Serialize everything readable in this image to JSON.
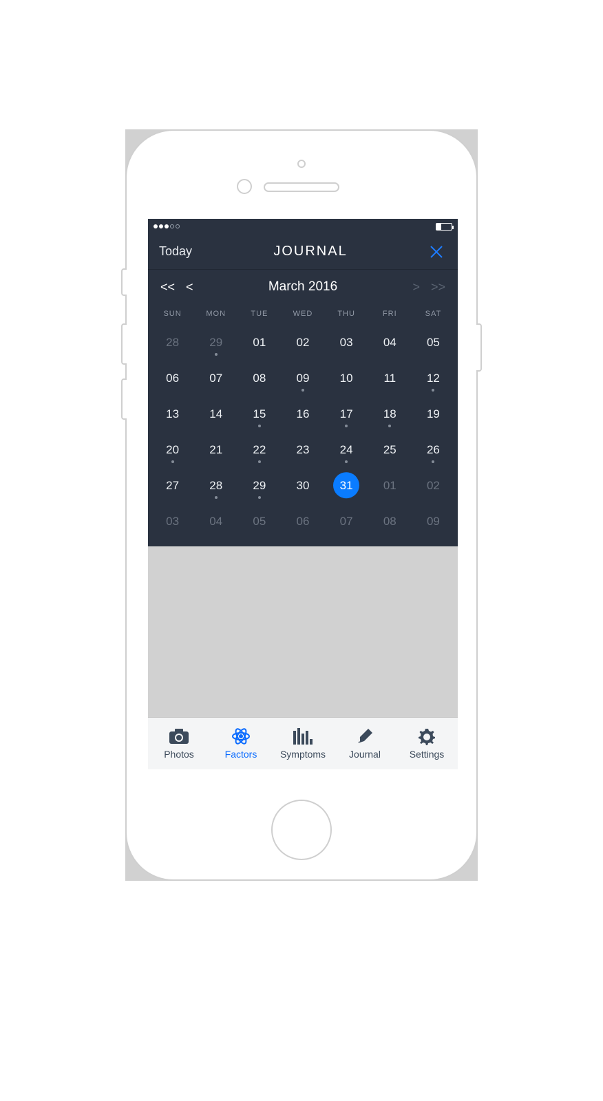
{
  "statusbar": {
    "signal_filled": 3,
    "signal_total": 5
  },
  "header": {
    "today_label": "Today",
    "title": "JOURNAL",
    "close_label": "Close"
  },
  "calendar": {
    "month_label": "March 2016",
    "nav": {
      "prev_year": "<<",
      "prev_month": "<",
      "next_month": ">",
      "next_year": ">>"
    },
    "weekdays": [
      "SUN",
      "MON",
      "TUE",
      "WED",
      "THU",
      "FRI",
      "SAT"
    ],
    "weeks": [
      [
        {
          "n": "28",
          "out": true
        },
        {
          "n": "29",
          "out": true,
          "dot": true
        },
        {
          "n": "01"
        },
        {
          "n": "02"
        },
        {
          "n": "03"
        },
        {
          "n": "04"
        },
        {
          "n": "05"
        }
      ],
      [
        {
          "n": "06"
        },
        {
          "n": "07"
        },
        {
          "n": "08"
        },
        {
          "n": "09",
          "dot": true
        },
        {
          "n": "10"
        },
        {
          "n": "11"
        },
        {
          "n": "12",
          "dot": true
        }
      ],
      [
        {
          "n": "13"
        },
        {
          "n": "14"
        },
        {
          "n": "15",
          "dot": true
        },
        {
          "n": "16"
        },
        {
          "n": "17",
          "dot": true
        },
        {
          "n": "18",
          "dot": true
        },
        {
          "n": "19"
        }
      ],
      [
        {
          "n": "20",
          "dot": true
        },
        {
          "n": "21"
        },
        {
          "n": "22",
          "dot": true
        },
        {
          "n": "23"
        },
        {
          "n": "24",
          "dot": true
        },
        {
          "n": "25"
        },
        {
          "n": "26",
          "dot": true
        }
      ],
      [
        {
          "n": "27"
        },
        {
          "n": "28",
          "dot": true
        },
        {
          "n": "29",
          "dot": true
        },
        {
          "n": "30"
        },
        {
          "n": "31",
          "selected": true
        },
        {
          "n": "01",
          "out": true
        },
        {
          "n": "02",
          "out": true
        }
      ],
      [
        {
          "n": "03",
          "out": true
        },
        {
          "n": "04",
          "out": true
        },
        {
          "n": "05",
          "out": true
        },
        {
          "n": "06",
          "out": true
        },
        {
          "n": "07",
          "out": true
        },
        {
          "n": "08",
          "out": true
        },
        {
          "n": "09",
          "out": true
        }
      ]
    ]
  },
  "tabs": [
    {
      "id": "photos",
      "label": "Photos",
      "icon": "camera",
      "active": false
    },
    {
      "id": "factors",
      "label": "Factors",
      "icon": "atom",
      "active": true
    },
    {
      "id": "symptoms",
      "label": "Symptoms",
      "icon": "bars",
      "active": false
    },
    {
      "id": "journal",
      "label": "Journal",
      "icon": "pencil",
      "active": false
    },
    {
      "id": "settings",
      "label": "Settings",
      "icon": "gear",
      "active": false
    }
  ]
}
